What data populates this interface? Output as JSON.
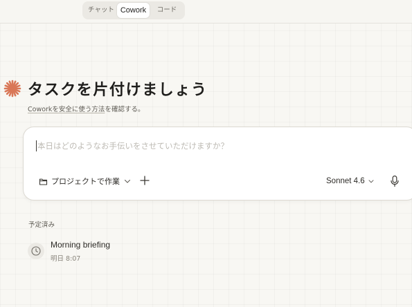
{
  "mode_tabs": [
    {
      "label": "チャット"
    },
    {
      "label": "Cowork"
    },
    {
      "label": "コード"
    }
  ],
  "active_tab": "Cowork",
  "headline": "タスクを片付けましょう",
  "subline": {
    "link_text": "Coworkを安全に使う方法",
    "suffix": "を確認する。"
  },
  "composer": {
    "placeholder": "本日はどのようなお手伝いをさせていただけますか？",
    "project_label": "プロジェクトで作業",
    "model_label": "Sonnet 4.6"
  },
  "scheduled": {
    "label": "予定済み",
    "items": [
      {
        "title": "Morning briefing",
        "time": "明日 8:07"
      }
    ]
  },
  "colors": {
    "accent": "#d97757",
    "background": "#f8f7f3",
    "card": "#ffffff"
  },
  "icons": [
    "sparkle-logo-icon",
    "folder-icon",
    "chevron-down-icon",
    "plus-icon",
    "microphone-icon",
    "clock-icon"
  ]
}
